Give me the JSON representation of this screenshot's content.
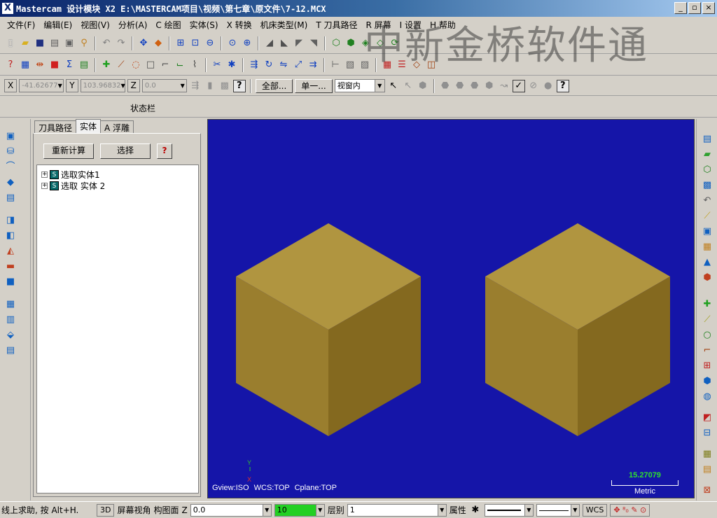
{
  "titlebar": {
    "title": "Mastercam 设计模块  X2  E:\\MASTERCAM项目\\视频\\第七章\\原文件\\7-12.MCX",
    "icon": "X",
    "min": "_",
    "max": "▫",
    "close": "×"
  },
  "menubar": {
    "items": [
      "文件(F)",
      "编辑(E)",
      "视图(V)",
      "分析(A)",
      "C 绘图",
      "实体(S)",
      "X 转换",
      "机床类型(M)",
      "T 刀具路径",
      "R 屏幕",
      "I 设置",
      "H 帮助"
    ]
  },
  "watermark": "中新金桥软件通",
  "toolbar3": {
    "x_label": "X",
    "x_value": "-41.62677",
    "y_label": "Y",
    "y_value": "103.96832",
    "z_label": "Z",
    "z_value": "0.0",
    "all_button": "全部...",
    "single_button": "单一...",
    "window_select": "视窗内"
  },
  "statusbar_label": "状态栏",
  "panel": {
    "tabs": [
      "刀具路径",
      "实体",
      "A 浮雕"
    ],
    "active_tab": 1,
    "recalc_button": "重新计算",
    "select_button": "选择",
    "help_button": "?",
    "tree": [
      {
        "label": "选取实体1",
        "expander": "+",
        "icon": "S"
      },
      {
        "label": "选取 实体 2",
        "expander": "+",
        "icon": "S"
      }
    ]
  },
  "viewport": {
    "background": "#1515a8",
    "cube_top": "#b09540",
    "cube_left": "#9a7e2e",
    "cube_right": "#84691f",
    "info": "Gview:ISO   WCS:TOP   Cplane:TOP",
    "axis_y": "Y",
    "axis_x": "X",
    "scale_value": "15.27079",
    "scale_unit": "Metric"
  },
  "bottombar": {
    "help_text": "线上求助, 按 Alt+H.",
    "btn_3d": "3D",
    "screen_view": "屏幕视角",
    "cplane": "构图面",
    "z_label": "Z",
    "z_value": "0.0",
    "color_value": "10",
    "level_label": "层别",
    "level_value": "1",
    "attr_label": "属性",
    "wcs": "WCS"
  }
}
